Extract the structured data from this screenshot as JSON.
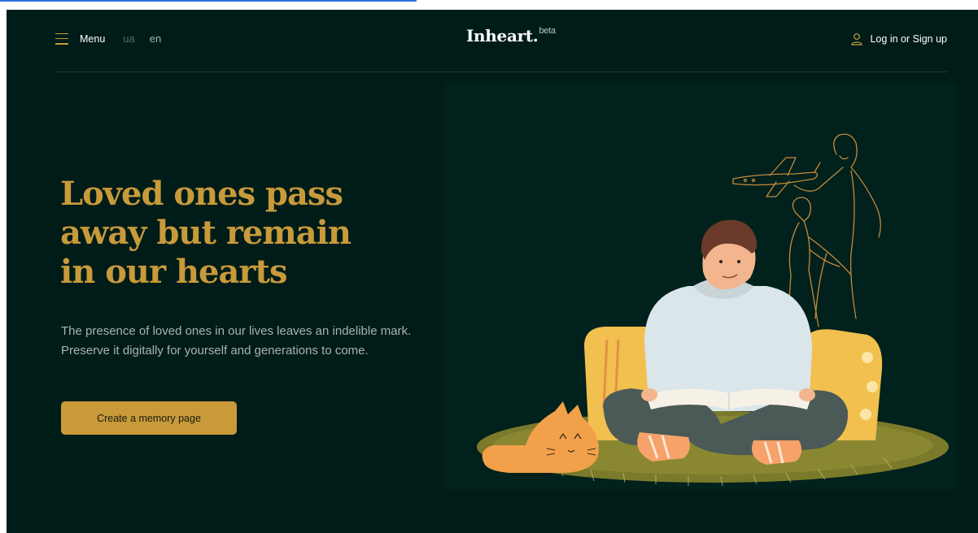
{
  "header": {
    "menu_label": "Menu",
    "languages": [
      {
        "code": "ua",
        "active": false
      },
      {
        "code": "en",
        "active": true
      }
    ],
    "logo_text": "Inheart.",
    "logo_badge": "beta",
    "login_label": "Log in or Sign up"
  },
  "hero": {
    "title_lines": [
      "Loved ones pass",
      "away but remain",
      "in our hearts"
    ],
    "subtitle": "The presence of loved ones in our lives leaves an indelible mark. Preserve it digitally for yourself and generations to come.",
    "cta_label": "Create a memory page"
  },
  "illustration": {
    "subject": "man reading a book on a cushion with a cat, line drawing of family memory above"
  },
  "colors": {
    "background": "#001c18",
    "accent": "#c89a3a",
    "text_muted": "#a8b4b0",
    "divider": "#1d3a33"
  },
  "icons": {
    "menu": "hamburger-icon",
    "user": "user-icon"
  }
}
